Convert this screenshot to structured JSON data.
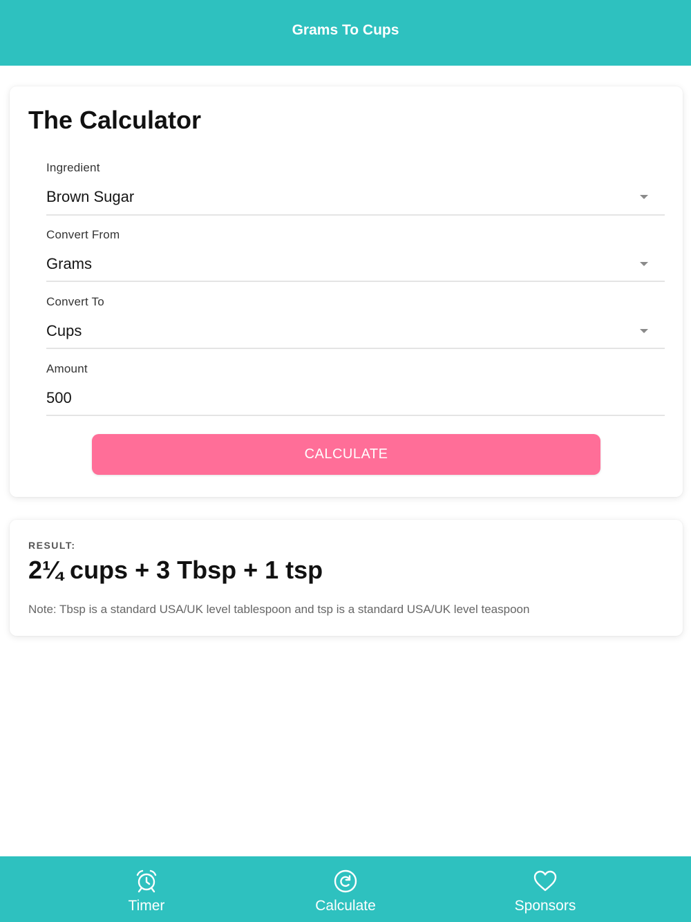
{
  "header": {
    "title": "Grams To Cups"
  },
  "calculator": {
    "title": "The Calculator",
    "fields": {
      "ingredient": {
        "label": "Ingredient",
        "value": "Brown Sugar"
      },
      "convert_from": {
        "label": "Convert From",
        "value": "Grams"
      },
      "convert_to": {
        "label": "Convert To",
        "value": "Cups"
      },
      "amount": {
        "label": "Amount",
        "value": "500"
      }
    },
    "calculate_label": "CALCULATE"
  },
  "result": {
    "label": "RESULT:",
    "value": "2¼ cups + 3 Tbsp + 1 tsp",
    "note": "Note: Tbsp is a standard USA/UK level tablespoon and tsp is a standard USA/UK level teaspoon"
  },
  "tabs": [
    {
      "label": "Timer",
      "icon": "alarm-clock-icon"
    },
    {
      "label": "Calculate",
      "icon": "refresh-circle-icon"
    },
    {
      "label": "Sponsors",
      "icon": "heart-icon"
    }
  ],
  "colors": {
    "primary": "#2ec1bf",
    "button": "#ff6e98",
    "divider": "#e4e4e4"
  }
}
